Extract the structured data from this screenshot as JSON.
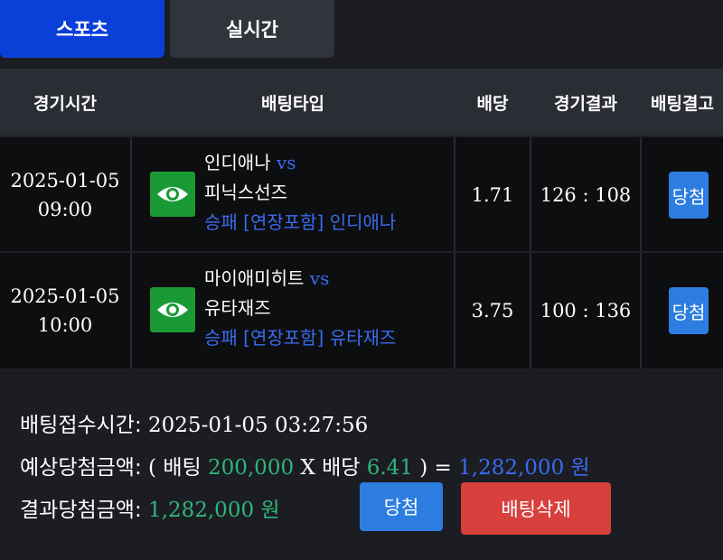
{
  "tabs": [
    "스포츠",
    "실시간"
  ],
  "columns": [
    "경기시간",
    "배팅타입",
    "배당",
    "경기결과",
    "배팅결고"
  ],
  "rows": [
    {
      "date": "2025-01-05",
      "time": "09:00",
      "home": "인디애나",
      "vs": "vs",
      "away": "피닉스선즈",
      "pick": "승패 [연장포함] 인디애나",
      "odds": "1.71",
      "result": "126 : 108",
      "status": "당첨"
    },
    {
      "date": "2025-01-05",
      "time": "10:00",
      "home": "마이애미히트",
      "vs": "vs",
      "away": "유타재즈",
      "pick": "승패 [연장포함] 유타재즈",
      "odds": "3.75",
      "result": "100 : 136",
      "status": "당첨"
    }
  ],
  "summary": {
    "receipt_label": "배팅접수시간:",
    "receipt_time": "2025-01-05 03:27:56",
    "expected_label": "예상당첨금액:",
    "open_paren": "(",
    "bet_label": "배팅",
    "bet_amount": "200,000",
    "times": "X",
    "odds_label": "배당",
    "total_odds": "6.41",
    "close_eq": ") =",
    "expected_amount": "1,282,000",
    "won1": "원",
    "result_label": "결과당첨금액:",
    "result_amount": "1,282,000",
    "won2": "원"
  },
  "buttons": {
    "win": "당첨",
    "delete": "배팅삭제"
  },
  "colors": {
    "tab_active": "#0a3fd8",
    "eye_button": "#1a9a35",
    "badge": "#2d7de0",
    "delete": "#d7403c",
    "accent_blue": "#3a6bf0",
    "accent_green": "#2fb57a"
  },
  "icons": {
    "detail": "eye-icon"
  }
}
